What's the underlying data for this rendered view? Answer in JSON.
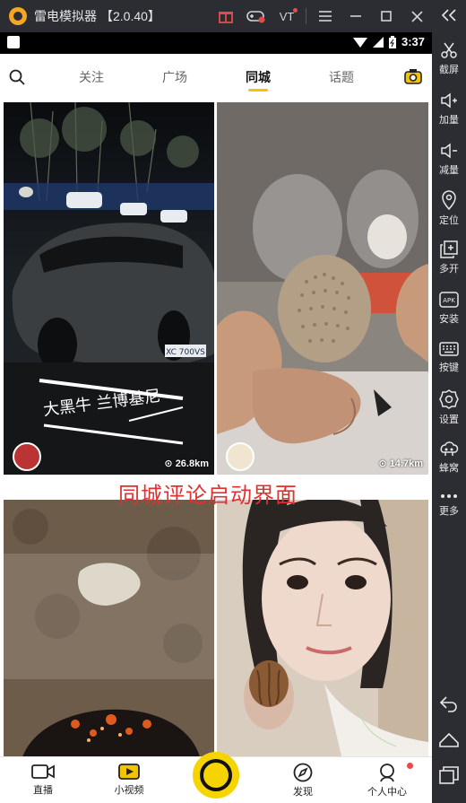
{
  "window": {
    "app_name": "雷电模拟器",
    "version": "【2.0.40】"
  },
  "statusbar": {
    "time": "3:37"
  },
  "topnav": {
    "tabs": [
      {
        "label": "关注"
      },
      {
        "label": "广场"
      },
      {
        "label": "同城"
      },
      {
        "label": "话题"
      }
    ],
    "active_tab": "同城"
  },
  "feed": {
    "cards": [
      {
        "caption": "大黑牛 兰博基尼",
        "plate": "XC 700VS",
        "distance": "26.8km"
      },
      {
        "distance": "14.7km"
      },
      {},
      {}
    ]
  },
  "overlay_text": "同城评论启动界面",
  "bottomnav": {
    "items": [
      {
        "label": "直播"
      },
      {
        "label": "小视频"
      },
      {
        "label": "发现"
      },
      {
        "label": "个人中心"
      }
    ]
  },
  "sidebar": {
    "items": [
      {
        "label": "截屏",
        "icon": "scissors-icon"
      },
      {
        "label": "加量",
        "icon": "volume-up-icon"
      },
      {
        "label": "减量",
        "icon": "volume-down-icon"
      },
      {
        "label": "定位",
        "icon": "location-icon"
      },
      {
        "label": "多开",
        "icon": "multi-open-icon"
      },
      {
        "label": "安装",
        "icon": "apk-icon"
      },
      {
        "label": "按键",
        "icon": "keyboard-icon"
      },
      {
        "label": "设置",
        "icon": "gear-icon"
      },
      {
        "label": "蜂窝",
        "icon": "hive-icon"
      },
      {
        "label": "更多",
        "icon": "more-icon"
      }
    ]
  },
  "colors": {
    "accent": "#f5c400",
    "watermark": "#e03030",
    "chrome": "#2b2d33"
  }
}
